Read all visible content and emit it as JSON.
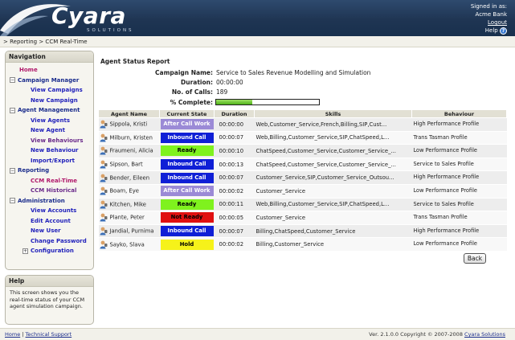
{
  "header": {
    "logo": "Cyara",
    "logo_sub": "SOLUTIONS",
    "signed_in": "Signed in as:",
    "company": "Acme Bank",
    "logout": "Logout",
    "help": "Help"
  },
  "breadcrumb": "> Reporting > CCM Real-Time",
  "nav": {
    "title": "Navigation",
    "home": "Home",
    "campaign_manager": "Campaign Manager",
    "view_campaigns": "View Campaigns",
    "new_campaign": "New Campaign",
    "agent_management": "Agent Management",
    "view_agents": "View Agents",
    "new_agent": "New Agent",
    "view_behaviours": "View Behaviours",
    "new_behaviour": "New Behaviour",
    "import_export": "Import/Export",
    "reporting": "Reporting",
    "ccm_realtime": "CCM Real-Time",
    "ccm_historical": "CCM Historical",
    "administration": "Administration",
    "view_accounts": "View Accounts",
    "edit_account": "Edit Account",
    "new_user": "New User",
    "change_password": "Change Password",
    "configuration": "Configuration"
  },
  "help_panel": {
    "title": "Help",
    "text": "This screen shows you the real-time status of your CCM agent simulation campaign."
  },
  "report": {
    "title": "Agent Status Report",
    "campaign_name_label": "Campaign Name:",
    "campaign_name": "Service to Sales Revenue Modelling and Simulation",
    "duration_label": "Duration:",
    "duration": "00:00:00",
    "calls_label": "No. of Calls:",
    "calls": "189",
    "complete_label": "% Complete:",
    "complete_fraction": 0.35
  },
  "table": {
    "headers": [
      "Agent Name",
      "Current State",
      "Duration",
      "Skills",
      "Behaviour"
    ],
    "rows": [
      {
        "name": "Sippola, Kristi",
        "state": "After Call Work",
        "duration": "00:00:00",
        "skills": "Web,Customer_Service,French,Billing,SIP,Cust...",
        "behaviour": "High Performance Profile"
      },
      {
        "name": "Milburn, Kristen",
        "state": "Inbound Call",
        "duration": "00:00:07",
        "skills": "Web,Billing,Customer_Service,SIP,ChatSpeed,L...",
        "behaviour": "Trans Tasman Profile"
      },
      {
        "name": "Fraumeni, Alicia",
        "state": "Ready",
        "duration": "00:00:10",
        "skills": "ChatSpeed,Customer_Service,Customer_Service_...",
        "behaviour": "Low Performance Profile"
      },
      {
        "name": "Sipson, Bart",
        "state": "Inbound Call",
        "duration": "00:00:13",
        "skills": "ChatSpeed,Customer_Service,Customer_Service_...",
        "behaviour": "Service to Sales Profile"
      },
      {
        "name": "Bender, Eileen",
        "state": "Inbound Call",
        "duration": "00:00:07",
        "skills": "Customer_Service,SIP,Customer_Service_Outsou...",
        "behaviour": "High Performance Profile"
      },
      {
        "name": "Boam, Eye",
        "state": "After Call Work",
        "duration": "00:00:02",
        "skills": "Customer_Service",
        "behaviour": "Low Performance Profile"
      },
      {
        "name": "Kitchen, Mike",
        "state": "Ready",
        "duration": "00:00:11",
        "skills": "Web,Billing,Customer_Service,SIP,ChatSpeed,L...",
        "behaviour": "Service to Sales Profile"
      },
      {
        "name": "Plante, Peter",
        "state": "Not Ready",
        "duration": "00:00:05",
        "skills": "Customer_Service",
        "behaviour": "Trans Tasman Profile"
      },
      {
        "name": "Jandial, Purnima",
        "state": "Inbound Call",
        "duration": "00:00:07",
        "skills": "Billing,ChatSpeed,Customer_Service",
        "behaviour": "High Performance Profile"
      },
      {
        "name": "Sayko, Slava",
        "state": "Hold",
        "duration": "00:00:02",
        "skills": "Billing,Customer_Service",
        "behaviour": "Low Performance Profile"
      }
    ]
  },
  "state_colors": {
    "After Call Work": {
      "bg": "#9b8ad6",
      "fg": "#ffffff"
    },
    "Inbound Call": {
      "bg": "#0f1fd6",
      "fg": "#ffffff"
    },
    "Ready": {
      "bg": "#7ff21e",
      "fg": "#000000"
    },
    "Not Ready": {
      "bg": "#e01010",
      "fg": "#000000"
    },
    "Hold": {
      "bg": "#f6f21a",
      "fg": "#000000"
    }
  },
  "back_label": "Back",
  "footer": {
    "home": "Home",
    "tech_support": "Technical Support",
    "version": "Ver. 2.1.0.0   Copyright © 2007-2008",
    "company_link": "Cyara Solutions"
  }
}
